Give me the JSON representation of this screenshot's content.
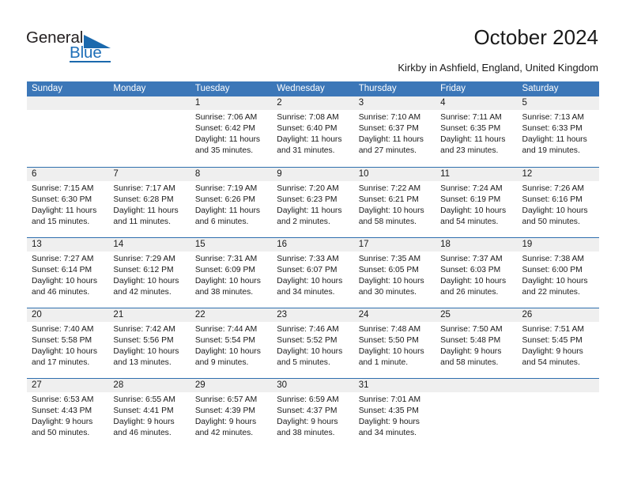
{
  "logo": {
    "word_top": "General",
    "word_bottom": "Blue",
    "accent_color": "#1b69ad",
    "triangle_icon": "triangle-icon"
  },
  "header": {
    "title": "October 2024",
    "subtitle": "Kirkby in Ashfield, England, United Kingdom"
  },
  "colors": {
    "header_row_bg": "#3c77b8",
    "week_divider": "#2f6fae",
    "day_band_bg": "#efefef",
    "text": "#1a1a1a"
  },
  "calendar": {
    "month": "October",
    "year": "2024",
    "weekdays": [
      "Sunday",
      "Monday",
      "Tuesday",
      "Wednesday",
      "Thursday",
      "Friday",
      "Saturday"
    ],
    "weeks": [
      [
        {
          "day": "",
          "lines": []
        },
        {
          "day": "",
          "lines": []
        },
        {
          "day": "1",
          "lines": [
            "Sunrise: 7:06 AM",
            "Sunset: 6:42 PM",
            "Daylight: 11 hours",
            "and 35 minutes."
          ]
        },
        {
          "day": "2",
          "lines": [
            "Sunrise: 7:08 AM",
            "Sunset: 6:40 PM",
            "Daylight: 11 hours",
            "and 31 minutes."
          ]
        },
        {
          "day": "3",
          "lines": [
            "Sunrise: 7:10 AM",
            "Sunset: 6:37 PM",
            "Daylight: 11 hours",
            "and 27 minutes."
          ]
        },
        {
          "day": "4",
          "lines": [
            "Sunrise: 7:11 AM",
            "Sunset: 6:35 PM",
            "Daylight: 11 hours",
            "and 23 minutes."
          ]
        },
        {
          "day": "5",
          "lines": [
            "Sunrise: 7:13 AM",
            "Sunset: 6:33 PM",
            "Daylight: 11 hours",
            "and 19 minutes."
          ]
        }
      ],
      [
        {
          "day": "6",
          "lines": [
            "Sunrise: 7:15 AM",
            "Sunset: 6:30 PM",
            "Daylight: 11 hours",
            "and 15 minutes."
          ]
        },
        {
          "day": "7",
          "lines": [
            "Sunrise: 7:17 AM",
            "Sunset: 6:28 PM",
            "Daylight: 11 hours",
            "and 11 minutes."
          ]
        },
        {
          "day": "8",
          "lines": [
            "Sunrise: 7:19 AM",
            "Sunset: 6:26 PM",
            "Daylight: 11 hours",
            "and 6 minutes."
          ]
        },
        {
          "day": "9",
          "lines": [
            "Sunrise: 7:20 AM",
            "Sunset: 6:23 PM",
            "Daylight: 11 hours",
            "and 2 minutes."
          ]
        },
        {
          "day": "10",
          "lines": [
            "Sunrise: 7:22 AM",
            "Sunset: 6:21 PM",
            "Daylight: 10 hours",
            "and 58 minutes."
          ]
        },
        {
          "day": "11",
          "lines": [
            "Sunrise: 7:24 AM",
            "Sunset: 6:19 PM",
            "Daylight: 10 hours",
            "and 54 minutes."
          ]
        },
        {
          "day": "12",
          "lines": [
            "Sunrise: 7:26 AM",
            "Sunset: 6:16 PM",
            "Daylight: 10 hours",
            "and 50 minutes."
          ]
        }
      ],
      [
        {
          "day": "13",
          "lines": [
            "Sunrise: 7:27 AM",
            "Sunset: 6:14 PM",
            "Daylight: 10 hours",
            "and 46 minutes."
          ]
        },
        {
          "day": "14",
          "lines": [
            "Sunrise: 7:29 AM",
            "Sunset: 6:12 PM",
            "Daylight: 10 hours",
            "and 42 minutes."
          ]
        },
        {
          "day": "15",
          "lines": [
            "Sunrise: 7:31 AM",
            "Sunset: 6:09 PM",
            "Daylight: 10 hours",
            "and 38 minutes."
          ]
        },
        {
          "day": "16",
          "lines": [
            "Sunrise: 7:33 AM",
            "Sunset: 6:07 PM",
            "Daylight: 10 hours",
            "and 34 minutes."
          ]
        },
        {
          "day": "17",
          "lines": [
            "Sunrise: 7:35 AM",
            "Sunset: 6:05 PM",
            "Daylight: 10 hours",
            "and 30 minutes."
          ]
        },
        {
          "day": "18",
          "lines": [
            "Sunrise: 7:37 AM",
            "Sunset: 6:03 PM",
            "Daylight: 10 hours",
            "and 26 minutes."
          ]
        },
        {
          "day": "19",
          "lines": [
            "Sunrise: 7:38 AM",
            "Sunset: 6:00 PM",
            "Daylight: 10 hours",
            "and 22 minutes."
          ]
        }
      ],
      [
        {
          "day": "20",
          "lines": [
            "Sunrise: 7:40 AM",
            "Sunset: 5:58 PM",
            "Daylight: 10 hours",
            "and 17 minutes."
          ]
        },
        {
          "day": "21",
          "lines": [
            "Sunrise: 7:42 AM",
            "Sunset: 5:56 PM",
            "Daylight: 10 hours",
            "and 13 minutes."
          ]
        },
        {
          "day": "22",
          "lines": [
            "Sunrise: 7:44 AM",
            "Sunset: 5:54 PM",
            "Daylight: 10 hours",
            "and 9 minutes."
          ]
        },
        {
          "day": "23",
          "lines": [
            "Sunrise: 7:46 AM",
            "Sunset: 5:52 PM",
            "Daylight: 10 hours",
            "and 5 minutes."
          ]
        },
        {
          "day": "24",
          "lines": [
            "Sunrise: 7:48 AM",
            "Sunset: 5:50 PM",
            "Daylight: 10 hours",
            "and 1 minute."
          ]
        },
        {
          "day": "25",
          "lines": [
            "Sunrise: 7:50 AM",
            "Sunset: 5:48 PM",
            "Daylight: 9 hours",
            "and 58 minutes."
          ]
        },
        {
          "day": "26",
          "lines": [
            "Sunrise: 7:51 AM",
            "Sunset: 5:45 PM",
            "Daylight: 9 hours",
            "and 54 minutes."
          ]
        }
      ],
      [
        {
          "day": "27",
          "lines": [
            "Sunrise: 6:53 AM",
            "Sunset: 4:43 PM",
            "Daylight: 9 hours",
            "and 50 minutes."
          ]
        },
        {
          "day": "28",
          "lines": [
            "Sunrise: 6:55 AM",
            "Sunset: 4:41 PM",
            "Daylight: 9 hours",
            "and 46 minutes."
          ]
        },
        {
          "day": "29",
          "lines": [
            "Sunrise: 6:57 AM",
            "Sunset: 4:39 PM",
            "Daylight: 9 hours",
            "and 42 minutes."
          ]
        },
        {
          "day": "30",
          "lines": [
            "Sunrise: 6:59 AM",
            "Sunset: 4:37 PM",
            "Daylight: 9 hours",
            "and 38 minutes."
          ]
        },
        {
          "day": "31",
          "lines": [
            "Sunrise: 7:01 AM",
            "Sunset: 4:35 PM",
            "Daylight: 9 hours",
            "and 34 minutes."
          ]
        },
        {
          "day": "",
          "lines": []
        },
        {
          "day": "",
          "lines": []
        }
      ]
    ]
  }
}
